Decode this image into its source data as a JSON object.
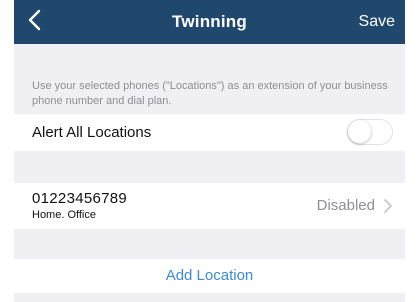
{
  "navbar": {
    "title": "Twinning",
    "save_label": "Save",
    "back_icon": "chevron-left-icon",
    "background_color": "#20476e"
  },
  "description": "Use your selected phones (\"Locations\") as an extension of your business phone number and dial plan.",
  "alert_all": {
    "label": "Alert All Locations",
    "toggle_on": false
  },
  "location": {
    "number": "01223456789",
    "labels": "Home. Office",
    "status": "Disabled",
    "chevron_icon": "chevron-right-icon"
  },
  "add_location": {
    "label": "Add Location",
    "color": "#3c8ad8"
  }
}
